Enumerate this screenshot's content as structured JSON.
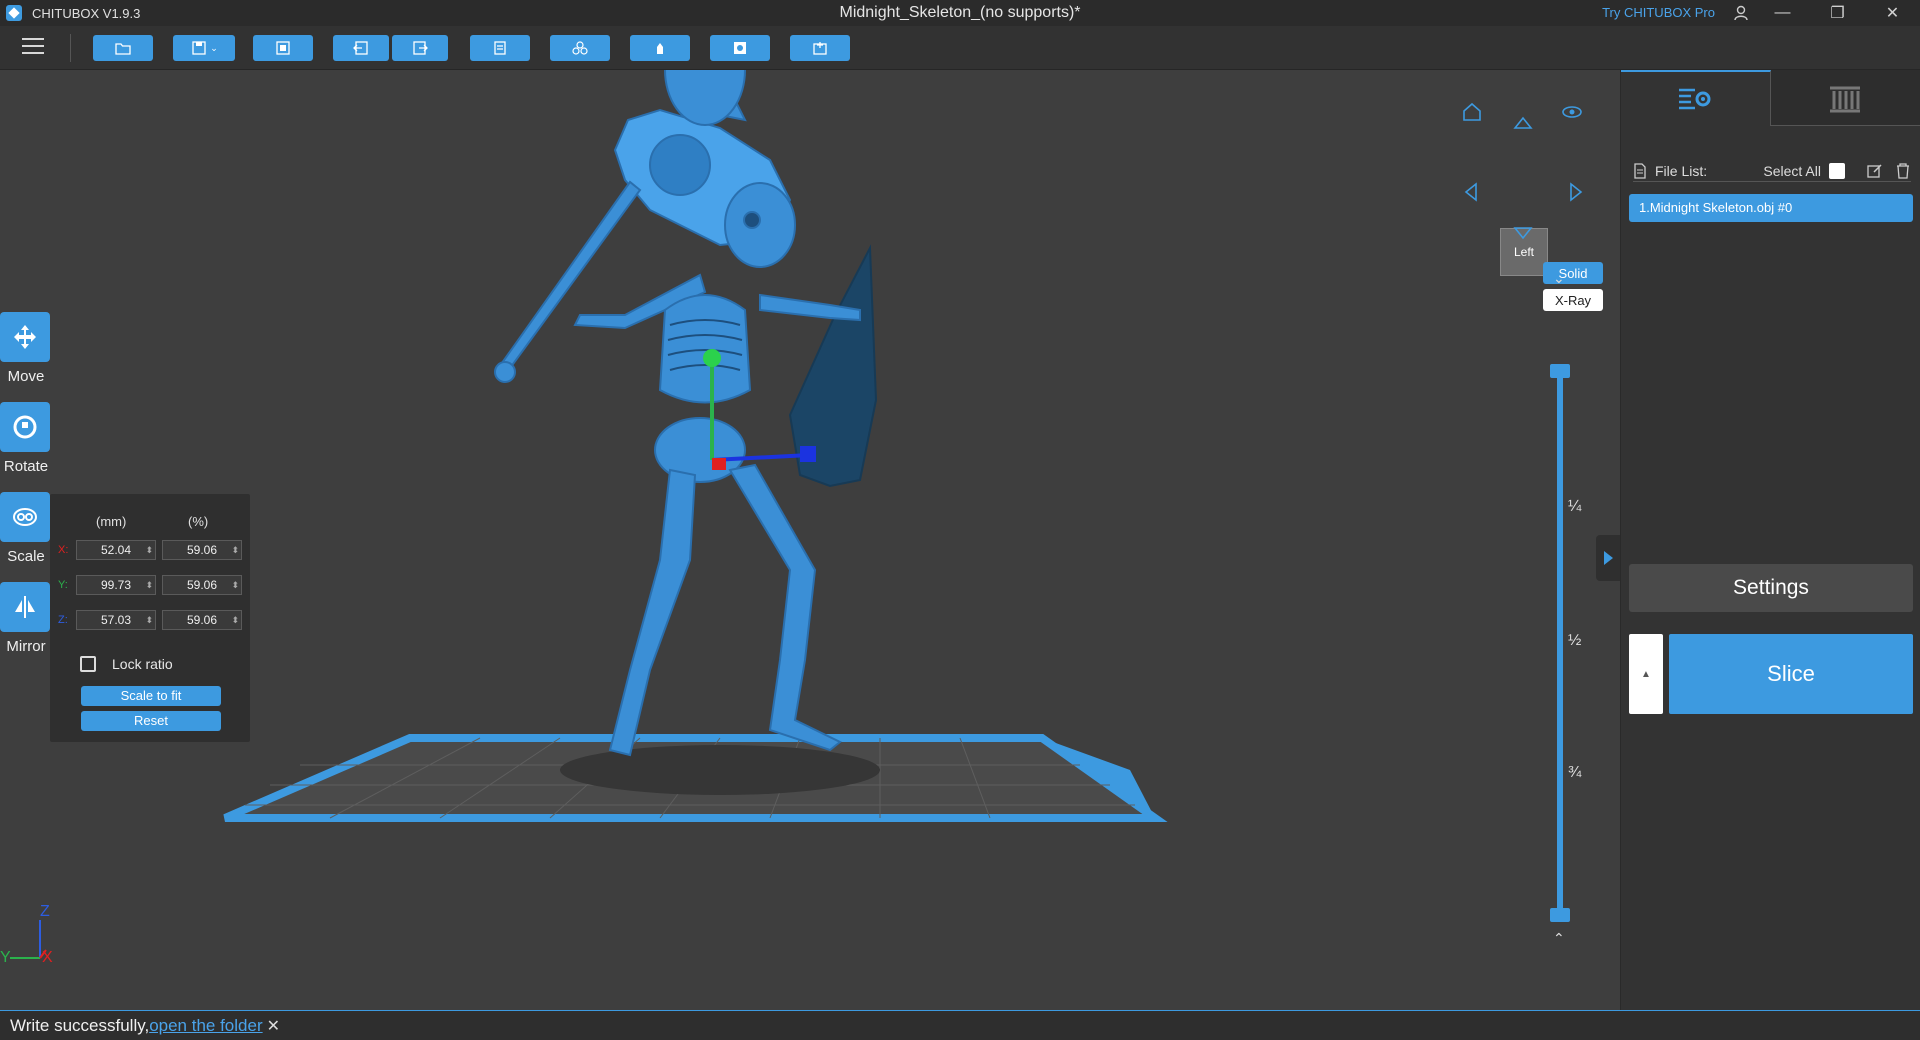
{
  "app": {
    "name": "CHITUBOX V1.9.3",
    "doc_title": "Midnight_Skeleton_(no supports)*",
    "try_pro": "Try CHITUBOX Pro"
  },
  "toolbar": {
    "buttons": [
      "open-folder",
      "save",
      "auto-layout",
      "undo",
      "redo",
      "copy",
      "arrange",
      "support",
      "hollow",
      "dig-hole"
    ]
  },
  "left_tools": [
    {
      "label": "Move",
      "icon": "move-icon"
    },
    {
      "label": "Rotate",
      "icon": "rotate-icon"
    },
    {
      "label": "Scale",
      "icon": "scale-icon"
    },
    {
      "label": "Mirror",
      "icon": "mirror-icon"
    }
  ],
  "scale_panel": {
    "header_mm": "(mm)",
    "header_pct": "(%)",
    "rows": [
      {
        "axis": "X:",
        "mm": "52.04",
        "pct": "59.06"
      },
      {
        "axis": "Y:",
        "mm": "99.73",
        "pct": "59.06"
      },
      {
        "axis": "Z:",
        "mm": "57.03",
        "pct": "59.06"
      }
    ],
    "lock_ratio": "Lock ratio",
    "scale_to_fit": "Scale to fit",
    "reset": "Reset"
  },
  "view": {
    "cube_label": "Left",
    "solid": "Solid",
    "xray": "X-Ray"
  },
  "slider": {
    "marks": [
      "¼",
      "½",
      "¾"
    ]
  },
  "file_panel": {
    "header": "File List:",
    "select_all": "Select All",
    "files": [
      "1.Midnight Skeleton.obj #0"
    ]
  },
  "buttons": {
    "settings": "Settings",
    "slice": "Slice"
  },
  "status": {
    "text": "Write successfully,",
    "link": "open the folder"
  },
  "axis_labels": {
    "z": "Z",
    "y": "Y",
    "x": "X"
  },
  "colors": {
    "accent": "#3d9ae0",
    "model": "#3b8fd6",
    "background": "#3e3e3e"
  }
}
